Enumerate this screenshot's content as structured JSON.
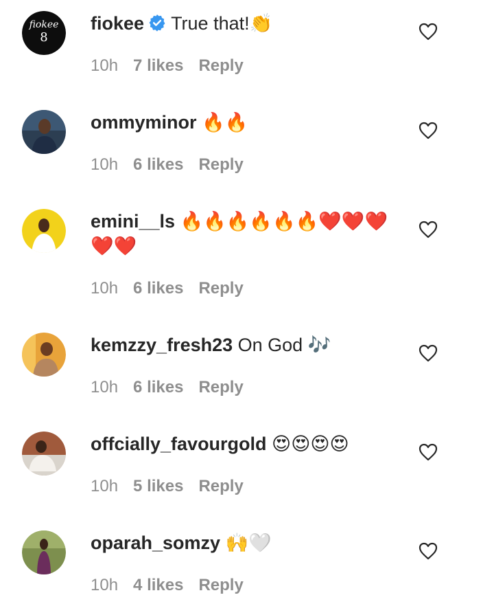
{
  "comments": [
    {
      "username": "fiokee",
      "verified": true,
      "text": "True that!👏",
      "time": "10h",
      "likes": "7 likes",
      "reply": "Reply"
    },
    {
      "username": "ommyminor",
      "verified": false,
      "text": " 🔥🔥",
      "time": "10h",
      "likes": "6 likes",
      "reply": "Reply"
    },
    {
      "username": "emini__ls",
      "verified": false,
      "text": " 🔥🔥🔥🔥🔥🔥❤️❤️❤️❤️❤️",
      "time": "10h",
      "likes": "6 likes",
      "reply": "Reply"
    },
    {
      "username": "kemzzy_fresh23",
      "verified": false,
      "text": " On God 🎶",
      "time": "10h",
      "likes": "6 likes",
      "reply": "Reply"
    },
    {
      "username": "offcially_favourgold",
      "verified": false,
      "text": " 😍😍😍😍",
      "time": "10h",
      "likes": "5 likes",
      "reply": "Reply"
    },
    {
      "username": "oparah_somzy",
      "verified": false,
      "text": " 🙌🤍",
      "time": "10h",
      "likes": "4 likes",
      "reply": "Reply"
    }
  ],
  "avatar_logo": {
    "word": "fiokee"
  },
  "colors": {
    "verified": "#3897f0",
    "meta": "#8e8e8e",
    "text": "#262626"
  }
}
